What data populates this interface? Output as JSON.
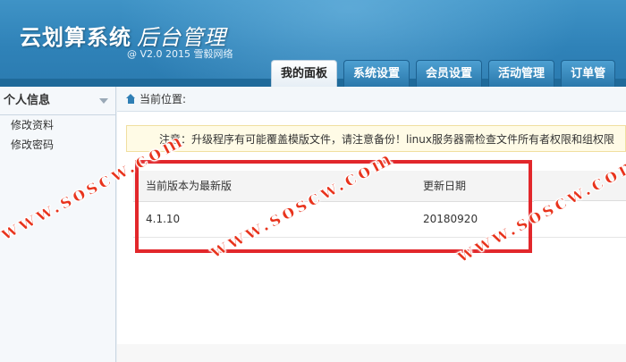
{
  "header": {
    "brand": "云划算系统",
    "brand_sub": "后台管理",
    "version": "@ V2.0 2015 雪毅网络"
  },
  "tabs": [
    {
      "label": "我的面板",
      "active": true
    },
    {
      "label": "系统设置",
      "active": false
    },
    {
      "label": "会员设置",
      "active": false
    },
    {
      "label": "活动管理",
      "active": false
    },
    {
      "label": "订单管",
      "active": false
    }
  ],
  "sidebar": {
    "title": "个人信息",
    "items": [
      {
        "label": "修改资料"
      },
      {
        "label": "修改密码"
      }
    ]
  },
  "main": {
    "location_label": "当前位置:",
    "notice": "注意：升级程序有可能覆盖模版文件，请注意备份！linux服务器需检查文件所有者权限和组权限",
    "table": {
      "headers": [
        "当前版本为最新版",
        "更新日期"
      ],
      "rows": [
        [
          "4.1.10",
          "20180920"
        ]
      ]
    }
  },
  "watermark": "www.soscw.com",
  "colors": {
    "header_blue": "#2f82b8",
    "highlight_red": "#e2272b",
    "watermark_red": "#e8331c"
  }
}
